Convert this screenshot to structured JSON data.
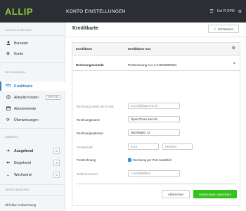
{
  "topbar": {
    "logo": "ALLIP",
    "title": "KONTO EINSTELLUNGEN",
    "menu_icon": "grid-menu-icon",
    "user": "Uni R OPN",
    "user_icon": "settings-icon"
  },
  "sidebar": {
    "section1": "KONTOLEUTEIGEN",
    "item_benutzer": "Benutzer",
    "item_konto": "Konto",
    "section2": "RECHNUNGEN",
    "item_kreditkarte": "Kreditkarte",
    "item_kosten": "Aktuelle Kosten",
    "kosten_badge": "CHF0.00",
    "item_abonnemente": "Abonnemente",
    "item_ueberweisungen": "Überweisungen",
    "section3": "ZÜBERSE",
    "item_ausgehend": "Ausgehend",
    "ausgehend_count": "0",
    "item_eingehend": "Eingehend",
    "eingehend_count": "0",
    "item_wechselnd": "Wechselnd",
    "wechselnd_count": "0",
    "section4": "VERSCHIEDENES",
    "footer": "Ufl fehlen Aufzeichnung"
  },
  "main": {
    "title": "Kreditkarte",
    "close_label": "Schliessen"
  },
  "panel": {
    "col1": "Kreditkarte",
    "col2": "Kreditkarte Aus",
    "subhead_label": "Rechnungskontakt",
    "subhead_value": "Postrechnung Aus (+41625980922)",
    "fields": {
      "email_label": "Rechnung direkt als E-mail",
      "email_value": "accenti@ptprem1.ch",
      "firma_label": "Rechnungsname",
      "firma_value": "Open Phone Net AG",
      "adresse_label": "Rechnungsadresse",
      "adresse_value": "Dachlingstr. 12",
      "plz_label": "Postleitzahl",
      "plz_value": "8213",
      "ort_value": "Neukirch",
      "post_label": "Postrechnung",
      "post_check_label": "Rechnung per Post zusätzlich",
      "telefon_label": "Telefonnummer",
      "telefon_value": "+41625980922"
    },
    "cancel_label": "Abbrechen",
    "save_label": "Änderungen speichern"
  }
}
